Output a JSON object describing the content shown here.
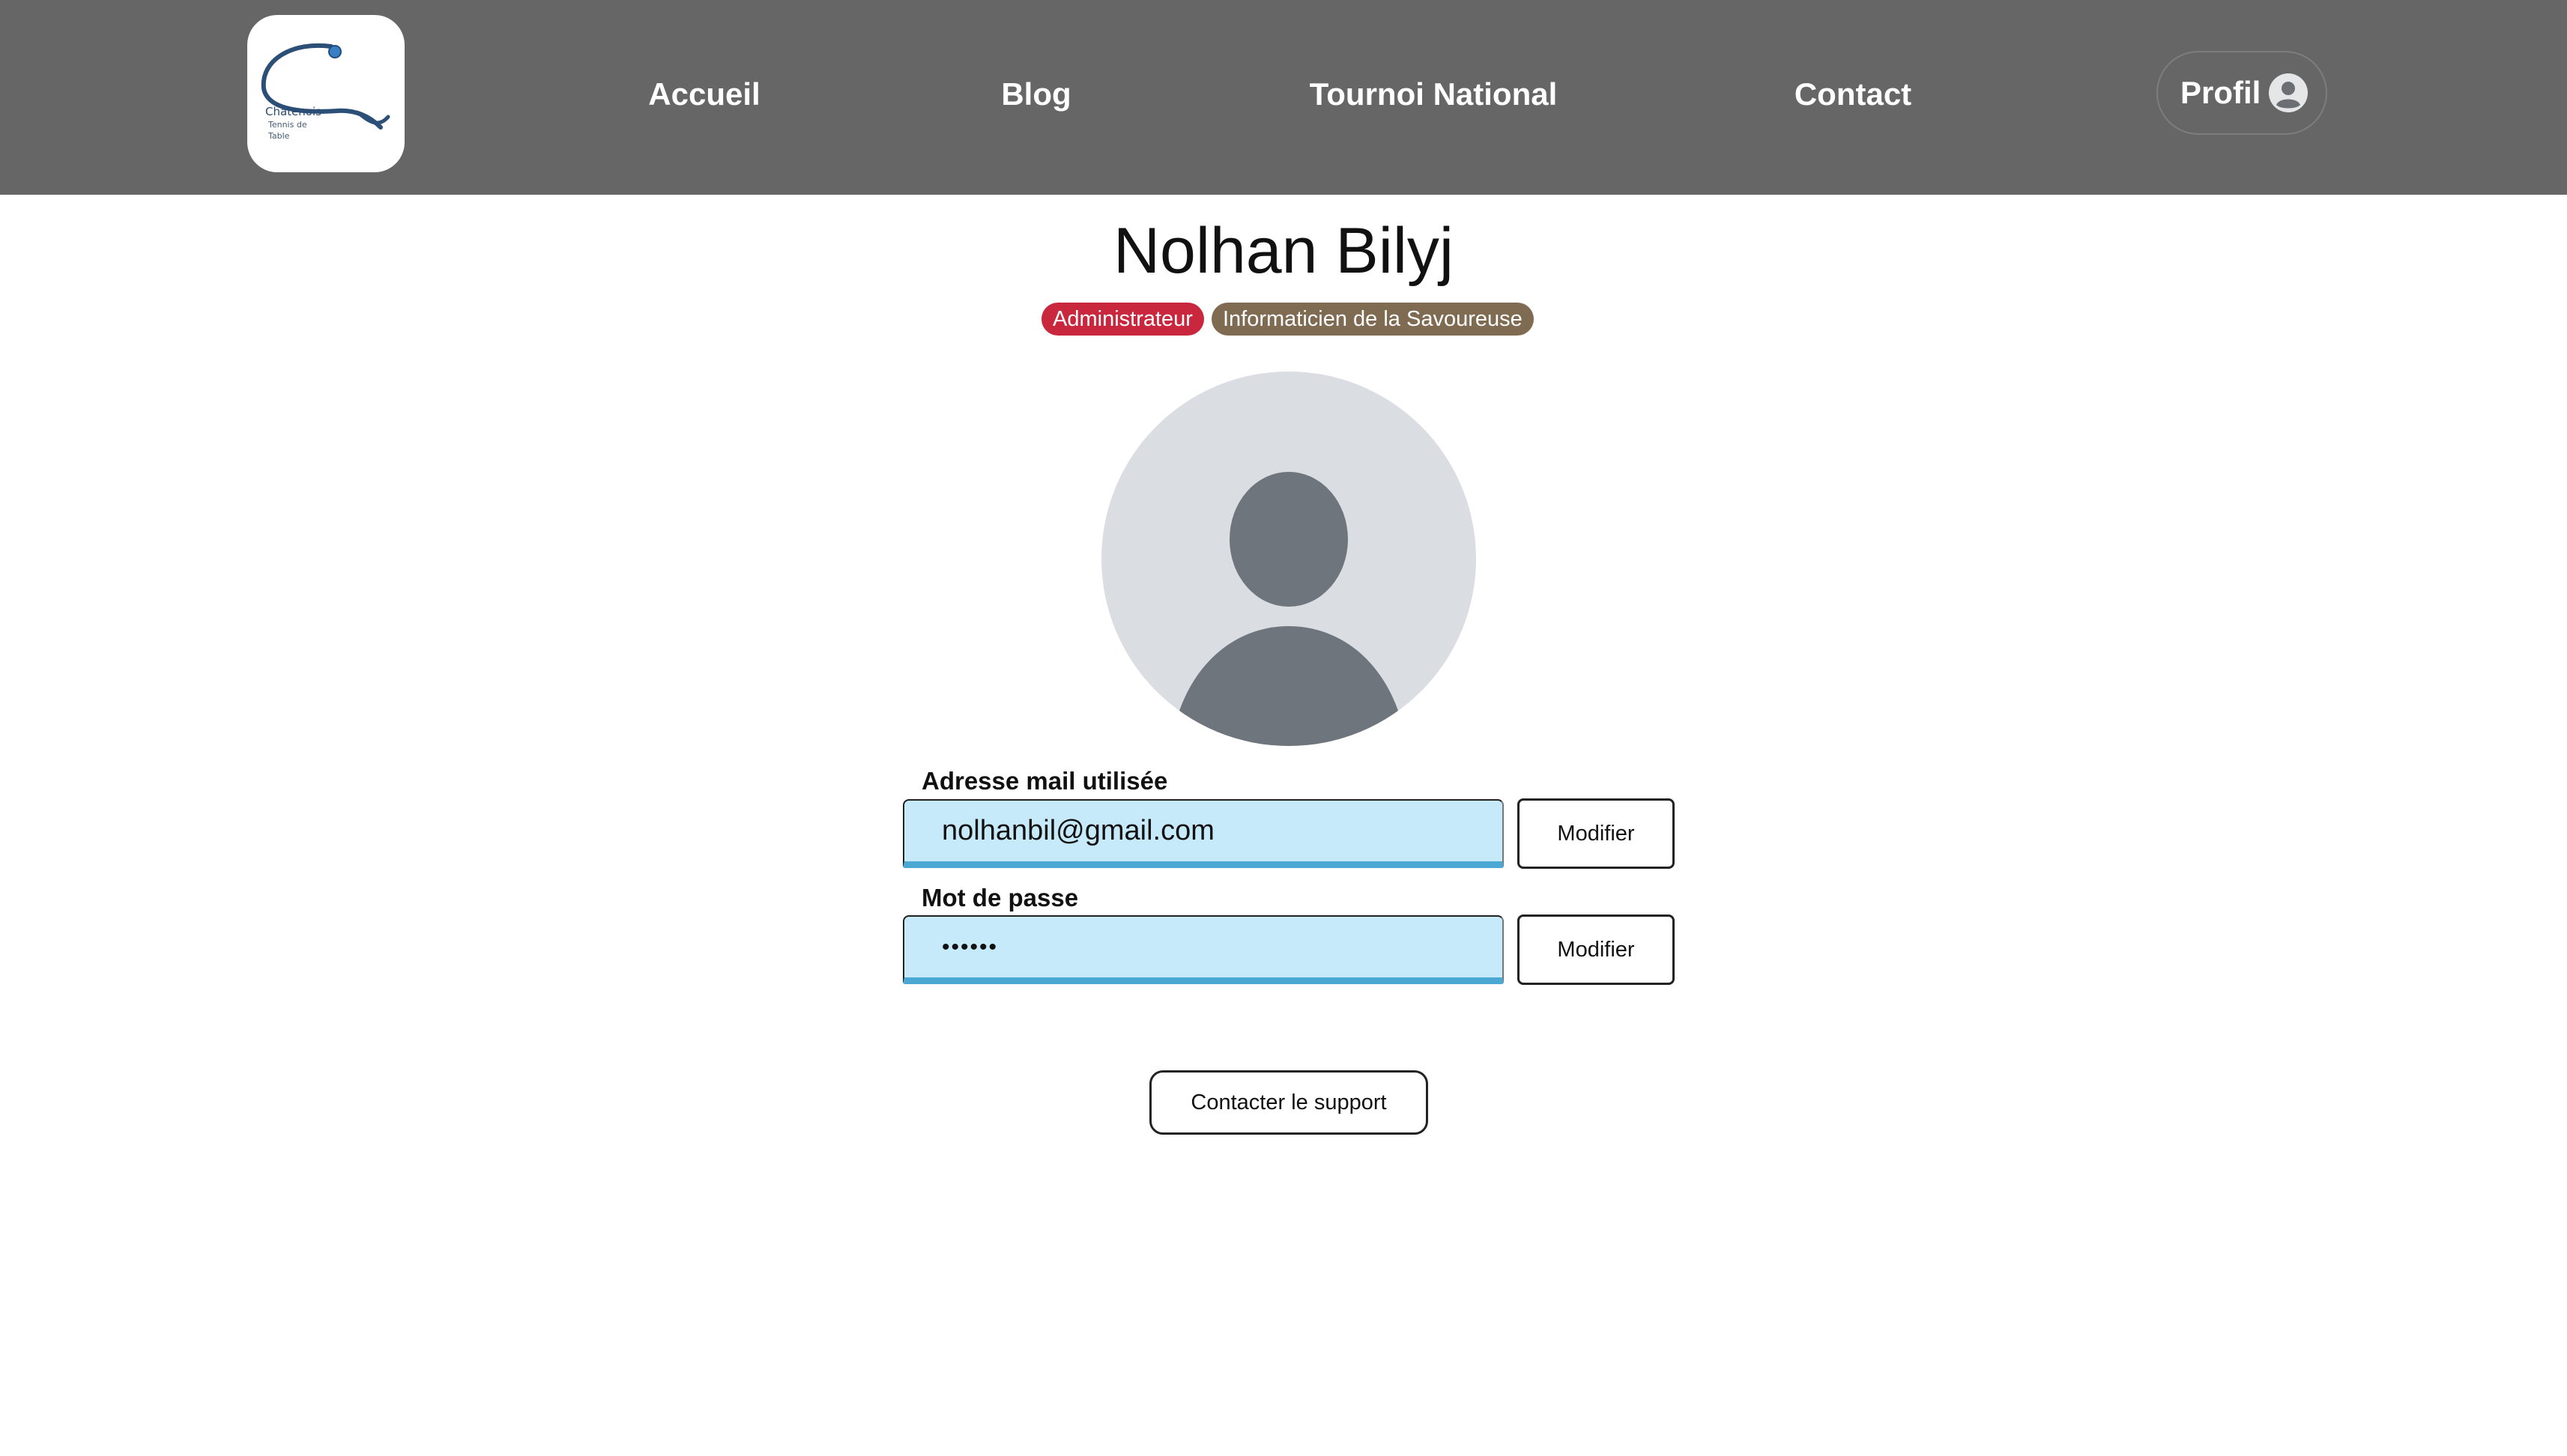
{
  "header": {
    "logo": {
      "icon": "club-logo-icon",
      "text_line1": "Châtenois",
      "text_line2": "Tennis de",
      "text_line3": "Table"
    },
    "nav": [
      {
        "label": "Accueil"
      },
      {
        "label": "Blog"
      },
      {
        "label": "Tournoi National"
      },
      {
        "label": "Contact"
      }
    ],
    "profile": {
      "label": "Profil",
      "icon": "user-circle-icon"
    }
  },
  "profile_page": {
    "name": "Nolhan Bilyj",
    "badges": [
      {
        "label": "Administrateur",
        "color": "#c9273d"
      },
      {
        "label": "Informaticien de la Savoureuse",
        "color": "#7f6b52"
      }
    ],
    "avatar_icon": "default-avatar-icon",
    "email": {
      "label": "Adresse mail utilisée",
      "value": "nolhanbil@gmail.com",
      "button_label": "Modifier"
    },
    "password": {
      "label": "Mot de passe",
      "value": "••••••",
      "button_label": "Modifier"
    },
    "support_button_label": "Contacter le support"
  },
  "colors": {
    "header_bg": "#666666",
    "field_bg": "#c7eafb",
    "field_underline": "#4aa8d3"
  }
}
